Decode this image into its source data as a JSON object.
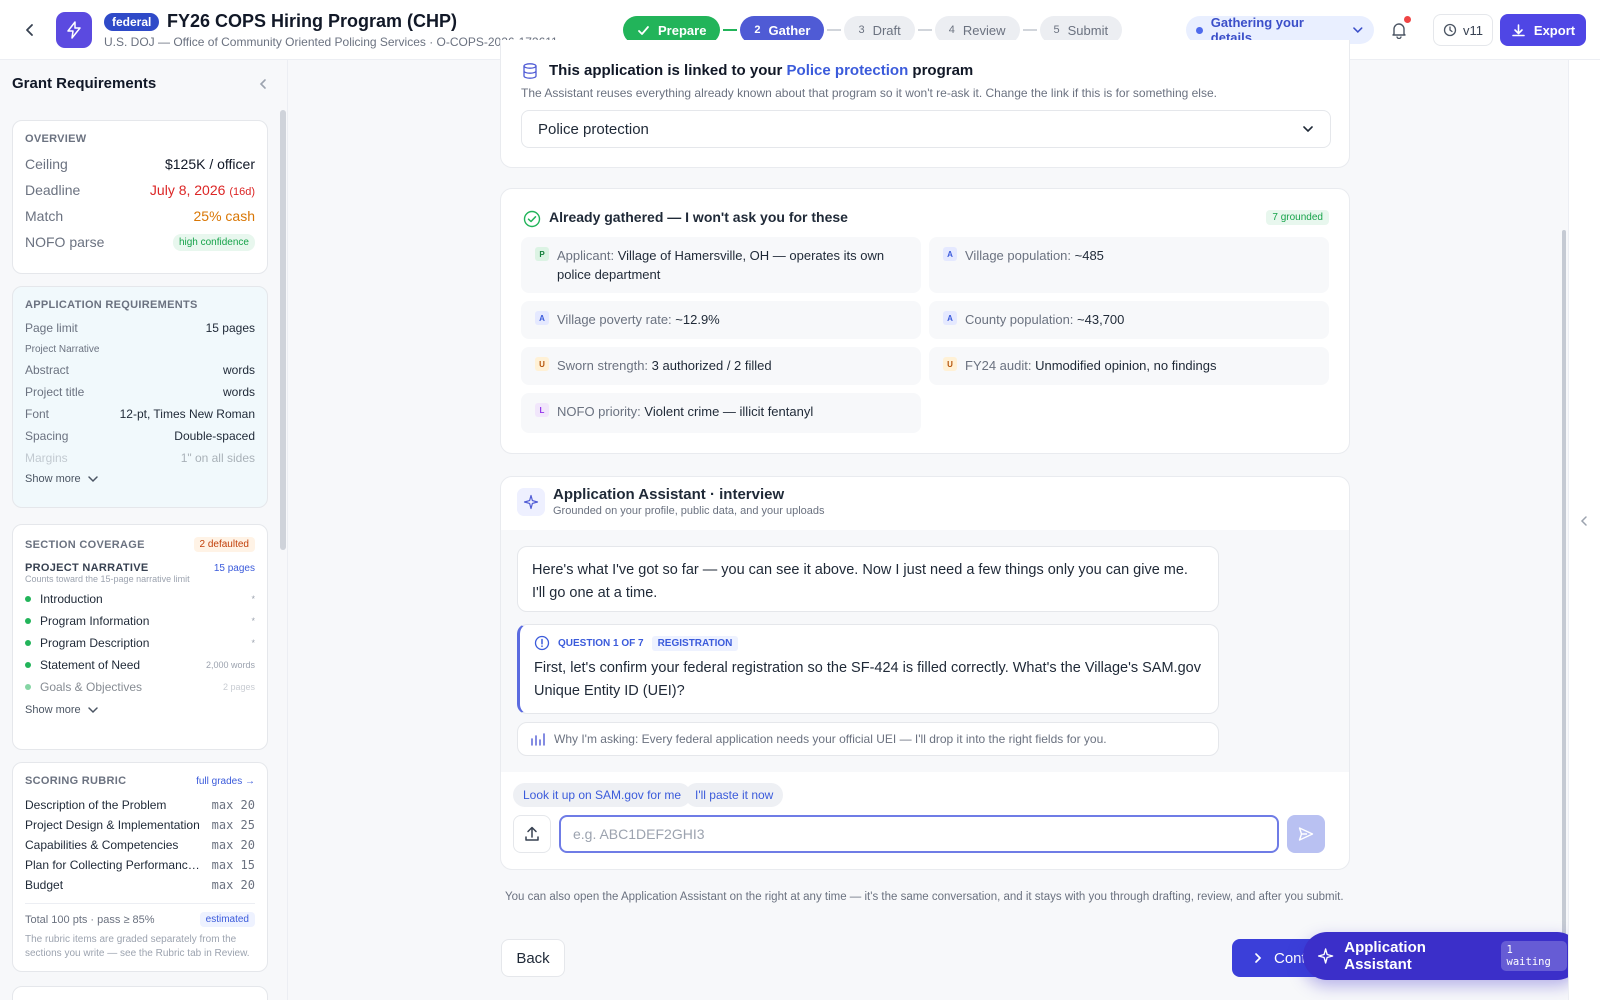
{
  "header": {
    "badge": "federal",
    "title": "FY26 COPS Hiring Program (CHP)",
    "subtitle": "U.S. DOJ — Office of Community Oriented Policing Services · O-COPS-2026-172611",
    "steps": [
      {
        "num": "",
        "label": "Prepare",
        "state": "done"
      },
      {
        "num": "2",
        "label": "Gather",
        "state": "active"
      },
      {
        "num": "3",
        "label": "Draft",
        "state": "todo"
      },
      {
        "num": "4",
        "label": "Review",
        "state": "todo"
      },
      {
        "num": "5",
        "label": "Submit",
        "state": "todo"
      }
    ],
    "status": "Gathering your details",
    "version": "v11",
    "export_label": "Export"
  },
  "sidebar": {
    "title": "Grant Requirements",
    "overview": {
      "heading": "OVERVIEW",
      "rows": [
        {
          "label": "Ceiling",
          "value": "$125K / officer"
        },
        {
          "label": "Deadline",
          "value": "July 8, 2026",
          "extra": "(16d)"
        },
        {
          "label": "Match",
          "value": "25% cash"
        },
        {
          "label": "NOFO parse",
          "value": "high confidence"
        }
      ]
    },
    "requirements": {
      "heading": "APPLICATION REQUIREMENTS",
      "rows": [
        {
          "label": "Page limit",
          "value": "15 pages"
        },
        {
          "label": "Project Narrative",
          "value": ""
        },
        {
          "label": "Abstract",
          "value": "words"
        },
        {
          "label": "Project title",
          "value": "words"
        },
        {
          "label": "Font",
          "value": "12-pt, Times New Roman"
        },
        {
          "label": "Spacing",
          "value": "Double-spaced"
        },
        {
          "label": "Margins",
          "value": "1\" on all sides"
        }
      ],
      "show_more": "Show more"
    },
    "coverage": {
      "heading": "SECTION COVERAGE",
      "badge": "2 defaulted",
      "section": "PROJECT NARRATIVE",
      "section_pages": "15 pages",
      "note": "Counts toward the 15-page narrative limit",
      "items": [
        {
          "label": "Introduction",
          "right": "*"
        },
        {
          "label": "Program Information",
          "right": "*"
        },
        {
          "label": "Program Description",
          "right": "*"
        },
        {
          "label": "Statement of Need",
          "right": "2,000 words"
        },
        {
          "label": "Goals & Objectives",
          "right": "2 pages"
        }
      ],
      "show_more": "Show more"
    },
    "rubric": {
      "heading": "SCORING RUBRIC",
      "link": "full grades →",
      "rows": [
        {
          "label": "Description of the Problem",
          "max": "max 20"
        },
        {
          "label": "Project Design & Implementation",
          "max": "max 25"
        },
        {
          "label": "Capabilities & Competencies",
          "max": "max 20"
        },
        {
          "label": "Plan for Collecting Performance Data",
          "max": "max 15"
        },
        {
          "label": "Budget",
          "max": "max 20"
        }
      ],
      "total": "Total 100 pts · pass ≥ 85%",
      "total_badge": "estimated",
      "footnote": "The rubric items are graded separately from the sections you write — see the Rubric tab in Review."
    }
  },
  "link_panel": {
    "title_pre": "This application is linked to your ",
    "title_link": "Police protection",
    "title_post": " program",
    "subtitle": "The Assistant reuses everything already known about that program so it won't re-ask it. Change the link if this is for something else.",
    "selected": "Police protection"
  },
  "gathered": {
    "title": "Already gathered — I won't ask you for these",
    "count": "7 grounded",
    "facts": [
      {
        "tag": "P",
        "label": "Applicant: ",
        "value": "Village of Hamersville, OH — operates its own police department"
      },
      {
        "tag": "A",
        "label": "Village population: ",
        "value": "~485"
      },
      {
        "tag": "A",
        "label": "Village poverty rate: ",
        "value": "~12.9%"
      },
      {
        "tag": "A",
        "label": "County population: ",
        "value": "~43,700"
      },
      {
        "tag": "U",
        "label": "Sworn strength: ",
        "value": "3 authorized / 2 filled"
      },
      {
        "tag": "U",
        "label": "FY24 audit: ",
        "value": "Unmodified opinion, no findings"
      },
      {
        "tag": "L",
        "label": "NOFO priority: ",
        "value": "Violent crime — illicit fentanyl"
      }
    ]
  },
  "assistant": {
    "title": "Application Assistant · interview",
    "subtitle": "Grounded on your profile, public data, and your uploads",
    "intro": "Here's what I've got so far — you can see it above. Now I just need a few things only you can give me. I'll go one at a time.",
    "question_label": "QUESTION 1 OF 7",
    "question_tag": "REGISTRATION",
    "question": "First, let's confirm your federal registration so the SF-424 is filled correctly. What's the Village's SAM.gov Unique Entity ID (UEI)?",
    "why": "Why I'm asking: Every federal application needs your official UEI — I'll drop it into the right fields for you.",
    "chips": [
      "Look it up on SAM.gov for me",
      "I'll paste it now"
    ],
    "input_placeholder": "e.g. ABC1DEF2GHI3"
  },
  "footer": {
    "note": "You can also open the Application Assistant on the right at any time — it's the same conversation, and it stays with you through drafting, review, and after you submit.",
    "back": "Back",
    "continue": "Continue",
    "fab_title": "Application Assistant",
    "fab_badge": "1 waiting"
  }
}
